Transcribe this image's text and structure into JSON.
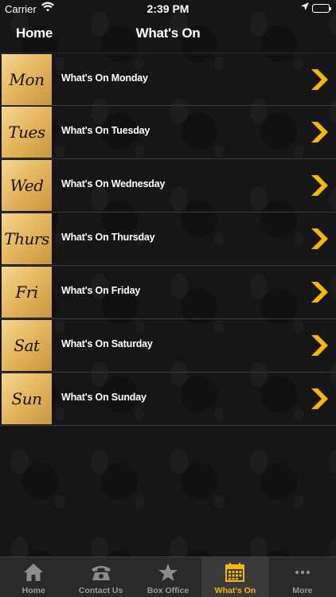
{
  "status": {
    "carrier": "Carrier",
    "time": "2:39 PM"
  },
  "nav": {
    "back_label": "Home",
    "title": "What's On"
  },
  "days": [
    {
      "tile": "Mon",
      "label": "What's On Monday"
    },
    {
      "tile": "Tues",
      "label": "What's On Tuesday"
    },
    {
      "tile": "Wed",
      "label": "What's On Wednesday"
    },
    {
      "tile": "Thurs",
      "label": "What's On Thursday"
    },
    {
      "tile": "Fri",
      "label": "What's On Friday"
    },
    {
      "tile": "Sat",
      "label": "What's On Saturday"
    },
    {
      "tile": "Sun",
      "label": "What's On Sunday"
    }
  ],
  "tabs": [
    {
      "label": "Home",
      "icon": "home-icon"
    },
    {
      "label": "Contact Us",
      "icon": "phone-icon"
    },
    {
      "label": "Box Office",
      "icon": "star-icon"
    },
    {
      "label": "What's On",
      "icon": "calendar-icon",
      "active": true
    },
    {
      "label": "More",
      "icon": "more-icon"
    }
  ],
  "colors": {
    "accent": "#f5b800",
    "tile_gold": "#e5b861"
  }
}
